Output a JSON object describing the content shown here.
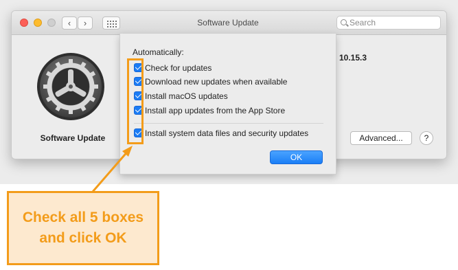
{
  "window": {
    "title": "Software Update",
    "search_placeholder": "Search"
  },
  "pane": {
    "label": "Software Update",
    "version": "10.15.3",
    "advanced_button": "Advanced...",
    "help_button": "?"
  },
  "sheet": {
    "heading": "Automatically:",
    "options": [
      {
        "label": "Check for updates",
        "checked": true
      },
      {
        "label": "Download new updates when available",
        "checked": true
      },
      {
        "label": "Install macOS updates",
        "checked": true
      },
      {
        "label": "Install app updates from the App Store",
        "checked": true
      },
      {
        "label": "Install system data files and security updates",
        "checked": true
      }
    ],
    "ok_button": "OK"
  },
  "annotation": {
    "text": "Check all 5 boxes and click OK"
  },
  "colors": {
    "accent": "#1b7cf5",
    "annotation": "#f39c1a",
    "annotation_fill": "#fde9cf"
  },
  "icons": [
    "back-chevron-icon",
    "forward-chevron-icon",
    "show-all-grid-icon",
    "search-icon",
    "software-update-gear-icon"
  ]
}
